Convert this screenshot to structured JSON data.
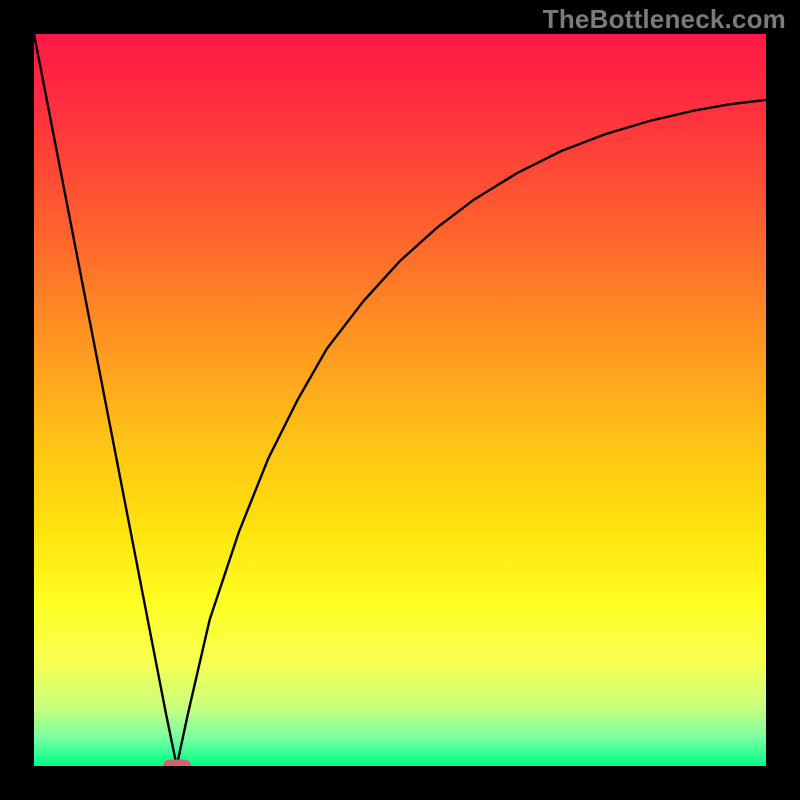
{
  "watermark": "TheBottleneck.com",
  "colors": {
    "frame": "#000000",
    "marker": "#d0626e",
    "curve": "#000000",
    "gradient_stops": [
      {
        "offset": 0.0,
        "color": "#ff1846"
      },
      {
        "offset": 0.1,
        "color": "#ff2f3f"
      },
      {
        "offset": 0.25,
        "color": "#ff5c2f"
      },
      {
        "offset": 0.4,
        "color": "#ff8f22"
      },
      {
        "offset": 0.55,
        "color": "#ffc116"
      },
      {
        "offset": 0.68,
        "color": "#ffe40e"
      },
      {
        "offset": 0.78,
        "color": "#ffff24"
      },
      {
        "offset": 0.86,
        "color": "#f6ff53"
      },
      {
        "offset": 0.92,
        "color": "#c8ff7d"
      },
      {
        "offset": 0.96,
        "color": "#7cffa1"
      },
      {
        "offset": 1.0,
        "color": "#00ff88"
      }
    ]
  },
  "chart_data": {
    "type": "line",
    "title": "",
    "xlabel": "",
    "ylabel": "",
    "xlim": [
      0,
      100
    ],
    "ylim": [
      0,
      100
    ],
    "legend": null,
    "note": "Single curve: steep linear descent from top-left to a minimum near x≈20, then a concave-down sqrt-like rise toward the upper-right. Values approximate (read from pixel positions).",
    "x": [
      0,
      2,
      4,
      6,
      8,
      10,
      12,
      14,
      16,
      18,
      19.5,
      21,
      24,
      28,
      32,
      36,
      40,
      45,
      50,
      55,
      60,
      66,
      72,
      78,
      84,
      90,
      95,
      100
    ],
    "y": [
      100,
      89.7,
      79.4,
      69.1,
      58.8,
      48.5,
      38.2,
      27.9,
      17.6,
      7.3,
      0,
      7,
      20,
      32,
      42,
      50,
      57,
      63.5,
      69,
      73.5,
      77.3,
      81,
      84,
      86.3,
      88.1,
      89.5,
      90.4,
      91
    ],
    "marker": {
      "x": 19.5,
      "y": 0
    }
  }
}
